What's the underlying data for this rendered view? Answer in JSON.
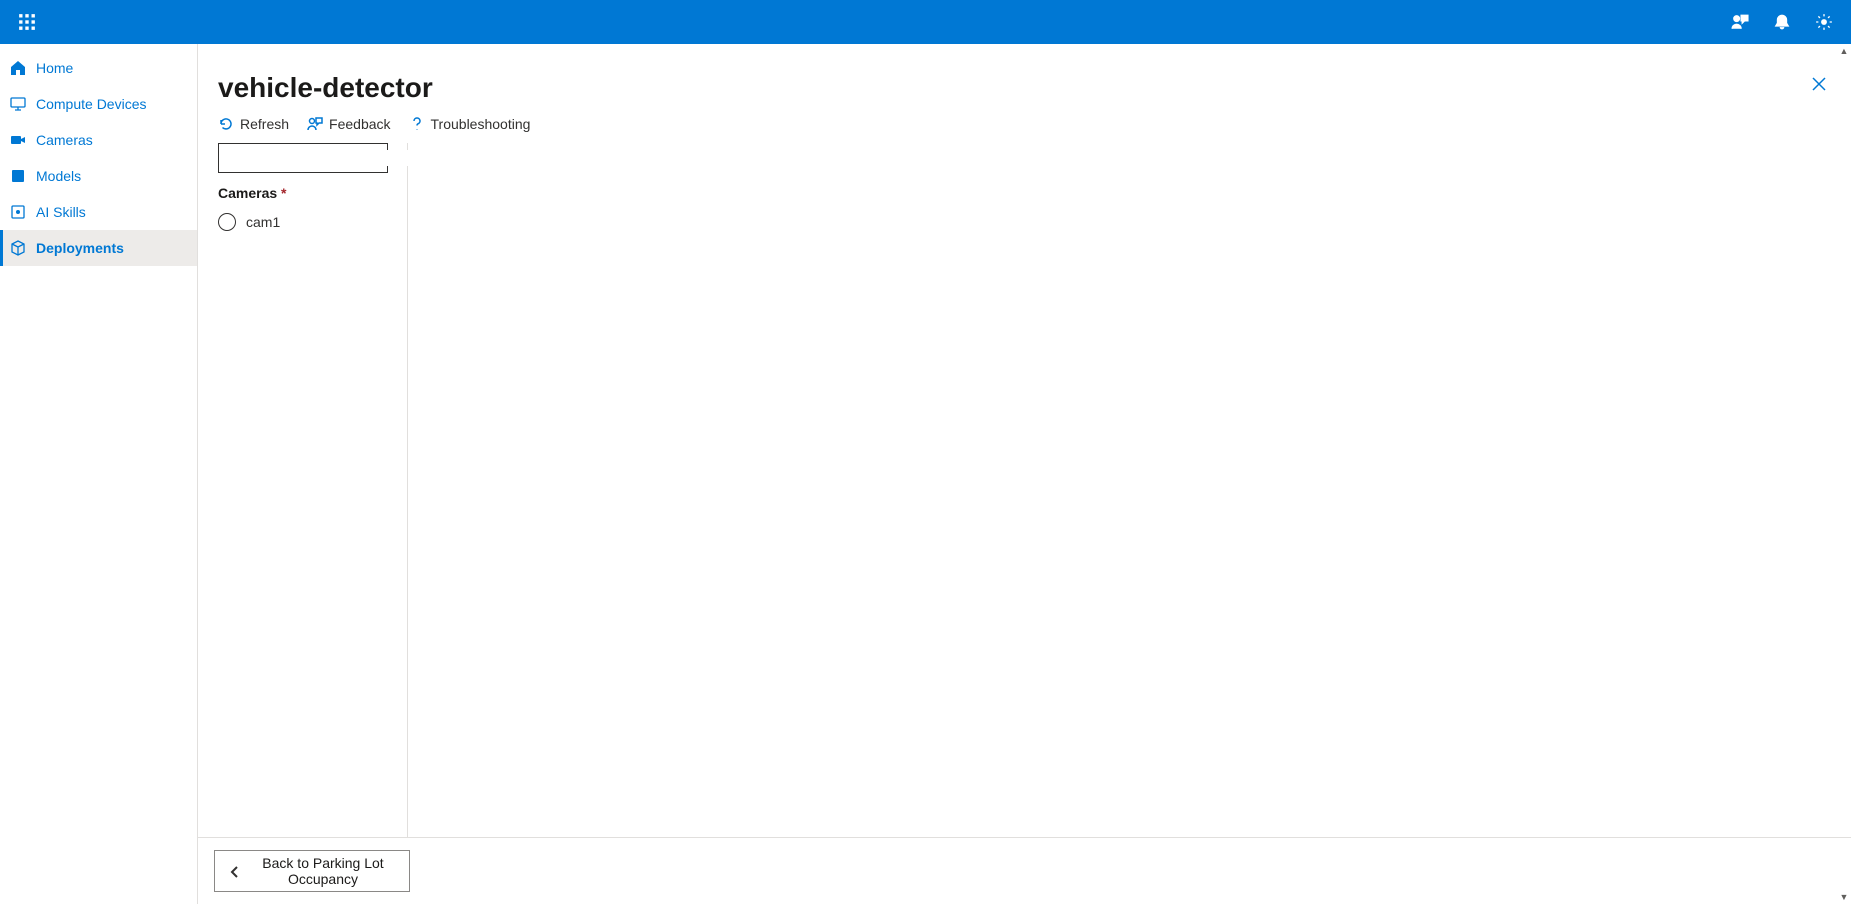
{
  "sidebar": {
    "items": [
      {
        "label": "Home"
      },
      {
        "label": "Compute Devices"
      },
      {
        "label": "Cameras"
      },
      {
        "label": "Models"
      },
      {
        "label": "AI Skills"
      },
      {
        "label": "Deployments"
      }
    ]
  },
  "page": {
    "title": "vehicle-detector"
  },
  "toolbar": {
    "refresh": "Refresh",
    "feedback": "Feedback",
    "troubleshooting": "Troubleshooting"
  },
  "panel": {
    "cameras_label": "Cameras",
    "required_mark": "*",
    "camera_items": [
      {
        "label": "cam1"
      }
    ]
  },
  "footer": {
    "back_label": "Back to Parking Lot Occupancy"
  }
}
